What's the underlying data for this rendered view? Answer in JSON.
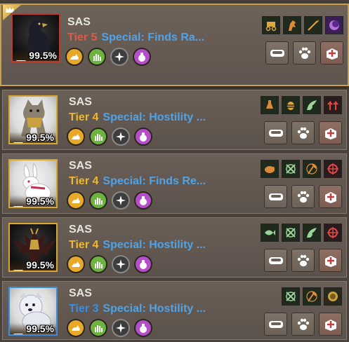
{
  "pets": [
    {
      "name": "SAS",
      "tier": "Tier 5",
      "tier_color": "#e05a4a",
      "special": "Special: Finds Ra...",
      "percent": "99.5%",
      "portrait": "black-eagle",
      "portrait_border": "#c0392b",
      "dark": true,
      "skills": [
        "carriage-icon",
        "horse-head-icon",
        "spear-icon",
        "purple-moon-icon"
      ]
    },
    {
      "name": "SAS",
      "tier": "Tier 4",
      "tier_color": "#f0b82c",
      "special": "Special: Hostility ...",
      "percent": "99.5%",
      "portrait": "armored-cat",
      "portrait_border": "#d8a72f",
      "dark": false,
      "skills": [
        "potion-icon",
        "bee-icon",
        "wing-icon",
        "red-arrows-icon"
      ]
    },
    {
      "name": "SAS",
      "tier": "Tier 4",
      "tier_color": "#f0b82c",
      "special": "Special: Finds Re...",
      "percent": "99.5%",
      "portrait": "white-rabbit",
      "portrait_border": "#d8a72f",
      "dark": false,
      "skills": [
        "beaver-icon",
        "crossed-pickaxe-icon",
        "axe-icon",
        "red-target-icon"
      ]
    },
    {
      "name": "SAS",
      "tier": "Tier 4",
      "tier_color": "#f0b82c",
      "special": "Special: Hostility ...",
      "percent": "99.5%",
      "portrait": "dark-dragon",
      "portrait_border": "#d8a72f",
      "dark": true,
      "skills": [
        "fish-icon",
        "crossed-pickaxe-icon",
        "wing-icon",
        "red-target-icon"
      ]
    },
    {
      "name": "SAS",
      "tier": "Tier 3",
      "tier_color": "#3b8de0",
      "special": "Special: Hostility ...",
      "percent": "99.5%",
      "portrait": "white-dog",
      "portrait_border": "#3b8de0",
      "dark": false,
      "skills": [
        "crossed-pickaxe-icon",
        "axe-icon",
        "gold-lion-icon"
      ]
    }
  ],
  "stat_icons": [
    "cat-stat-icon",
    "paw-hand-stat-icon",
    "compass-stat-icon",
    "pouch-stat-icon"
  ],
  "actions": [
    "feed-bowl-button",
    "paw-button",
    "release-button"
  ]
}
